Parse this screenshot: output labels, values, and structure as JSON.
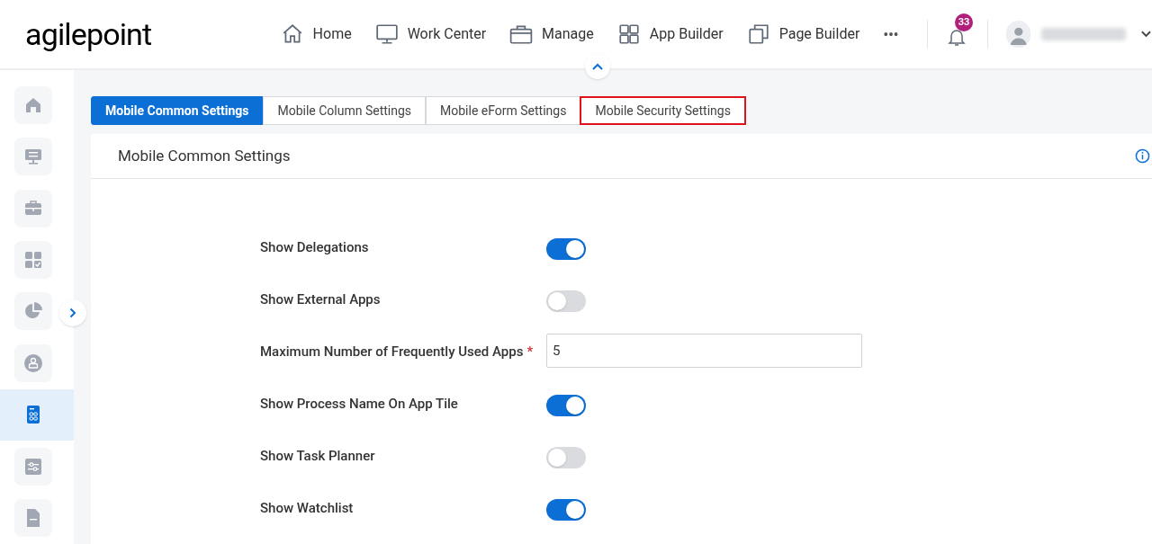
{
  "logo": "agilepoint",
  "nav": [
    {
      "label": "Home"
    },
    {
      "label": "Work Center"
    },
    {
      "label": "Manage"
    },
    {
      "label": "App Builder"
    },
    {
      "label": "Page Builder"
    }
  ],
  "more": "•••",
  "notifications": {
    "count": "33"
  },
  "sidebar": {
    "items": [
      {
        "selected": false
      },
      {
        "selected": false
      },
      {
        "selected": false
      },
      {
        "selected": false
      },
      {
        "selected": false
      },
      {
        "selected": false
      },
      {
        "selected": true
      },
      {
        "selected": false
      },
      {
        "selected": false
      }
    ]
  },
  "tabs": [
    {
      "label": "Mobile Common Settings",
      "selected": true,
      "highlighted": false
    },
    {
      "label": "Mobile Column Settings",
      "selected": false,
      "highlighted": false
    },
    {
      "label": "Mobile eForm Settings",
      "selected": false,
      "highlighted": false
    },
    {
      "label": "Mobile Security Settings",
      "selected": false,
      "highlighted": true
    }
  ],
  "panel": {
    "title": "Mobile Common Settings",
    "fields": [
      {
        "kind": "toggle",
        "label": "Show Delegations",
        "on": true
      },
      {
        "kind": "toggle",
        "label": "Show External Apps",
        "on": false
      },
      {
        "kind": "number",
        "label": "Maximum Number of Frequently Used Apps",
        "required_mark": "*",
        "value": "5"
      },
      {
        "kind": "toggle",
        "label": "Show Process Name On App Tile",
        "on": true
      },
      {
        "kind": "toggle",
        "label": "Show Task Planner",
        "on": false
      },
      {
        "kind": "toggle",
        "label": "Show Watchlist",
        "on": true
      }
    ]
  }
}
